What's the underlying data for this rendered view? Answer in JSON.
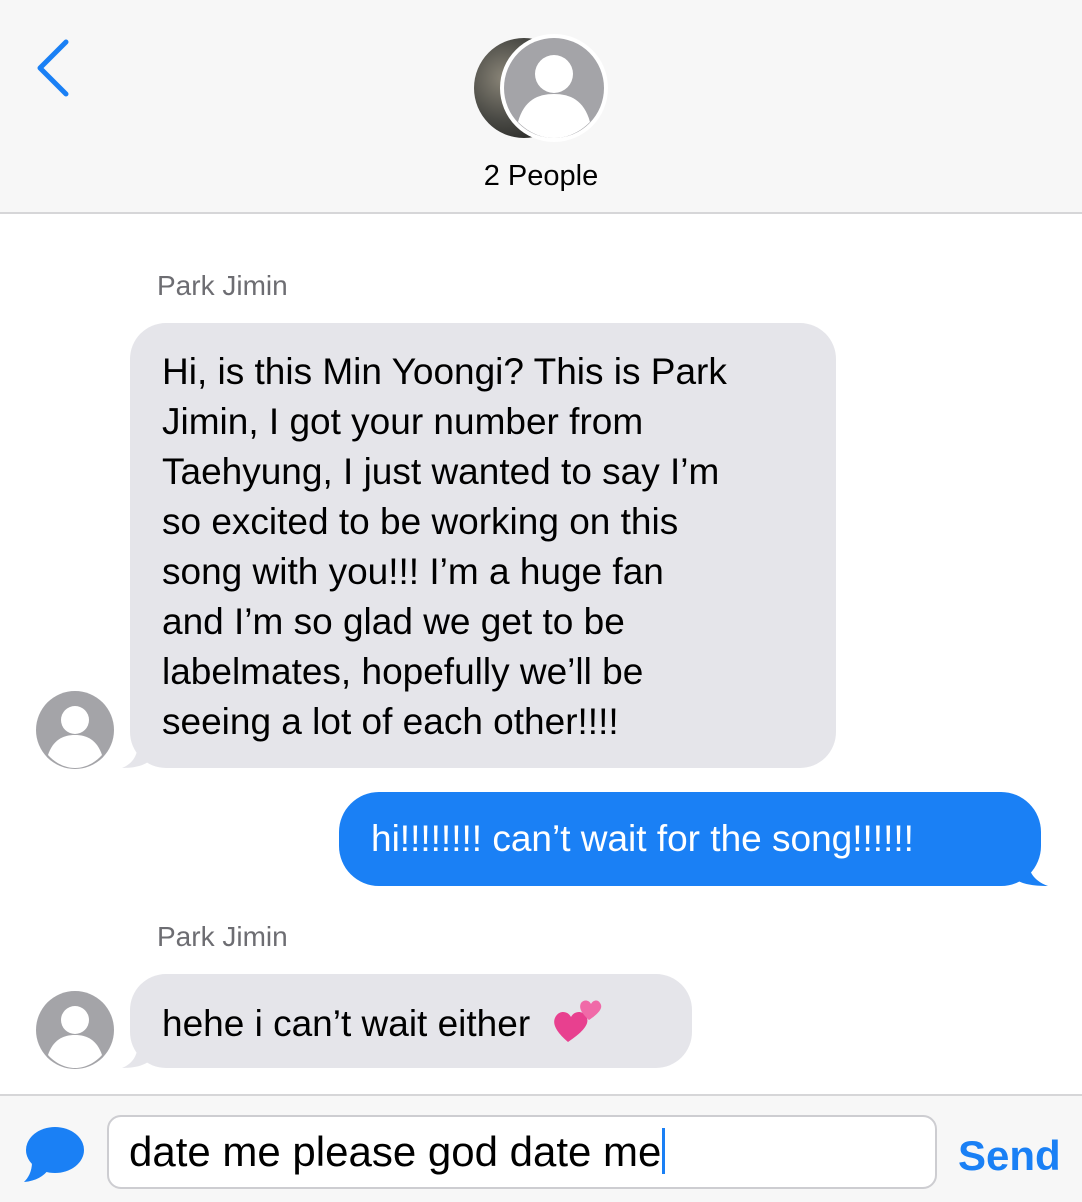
{
  "header": {
    "title": "2 People"
  },
  "messages": [
    {
      "sender": "Park Jimin",
      "lines": [
        "Hi, is this Min Yoongi? This is Park",
        "Jimin, I got your number from",
        "Taehyung, I just wanted to say I’m",
        "so excited to be working on this",
        "song with you!!! I’m a huge fan",
        "and I’m so glad we get to be",
        "labelmates, hopefully we’ll be",
        "seeing a lot of each other!!!!"
      ]
    },
    {
      "text": "hi!!!!!!!! can’t wait for the song!!!!!!"
    },
    {
      "sender": "Park Jimin",
      "text": "hehe i can’t wait either",
      "emoji": "heart-emoji"
    }
  ],
  "composer": {
    "value": "date me please god date me",
    "send_label": "Send"
  },
  "colors": {
    "accent": "#1a80f5",
    "incoming_bubble": "#e5e5ea",
    "outgoing_bubble": "#1a80f5",
    "bar_background": "#f7f7f7",
    "avatar_gray": "#a4a4a8"
  }
}
